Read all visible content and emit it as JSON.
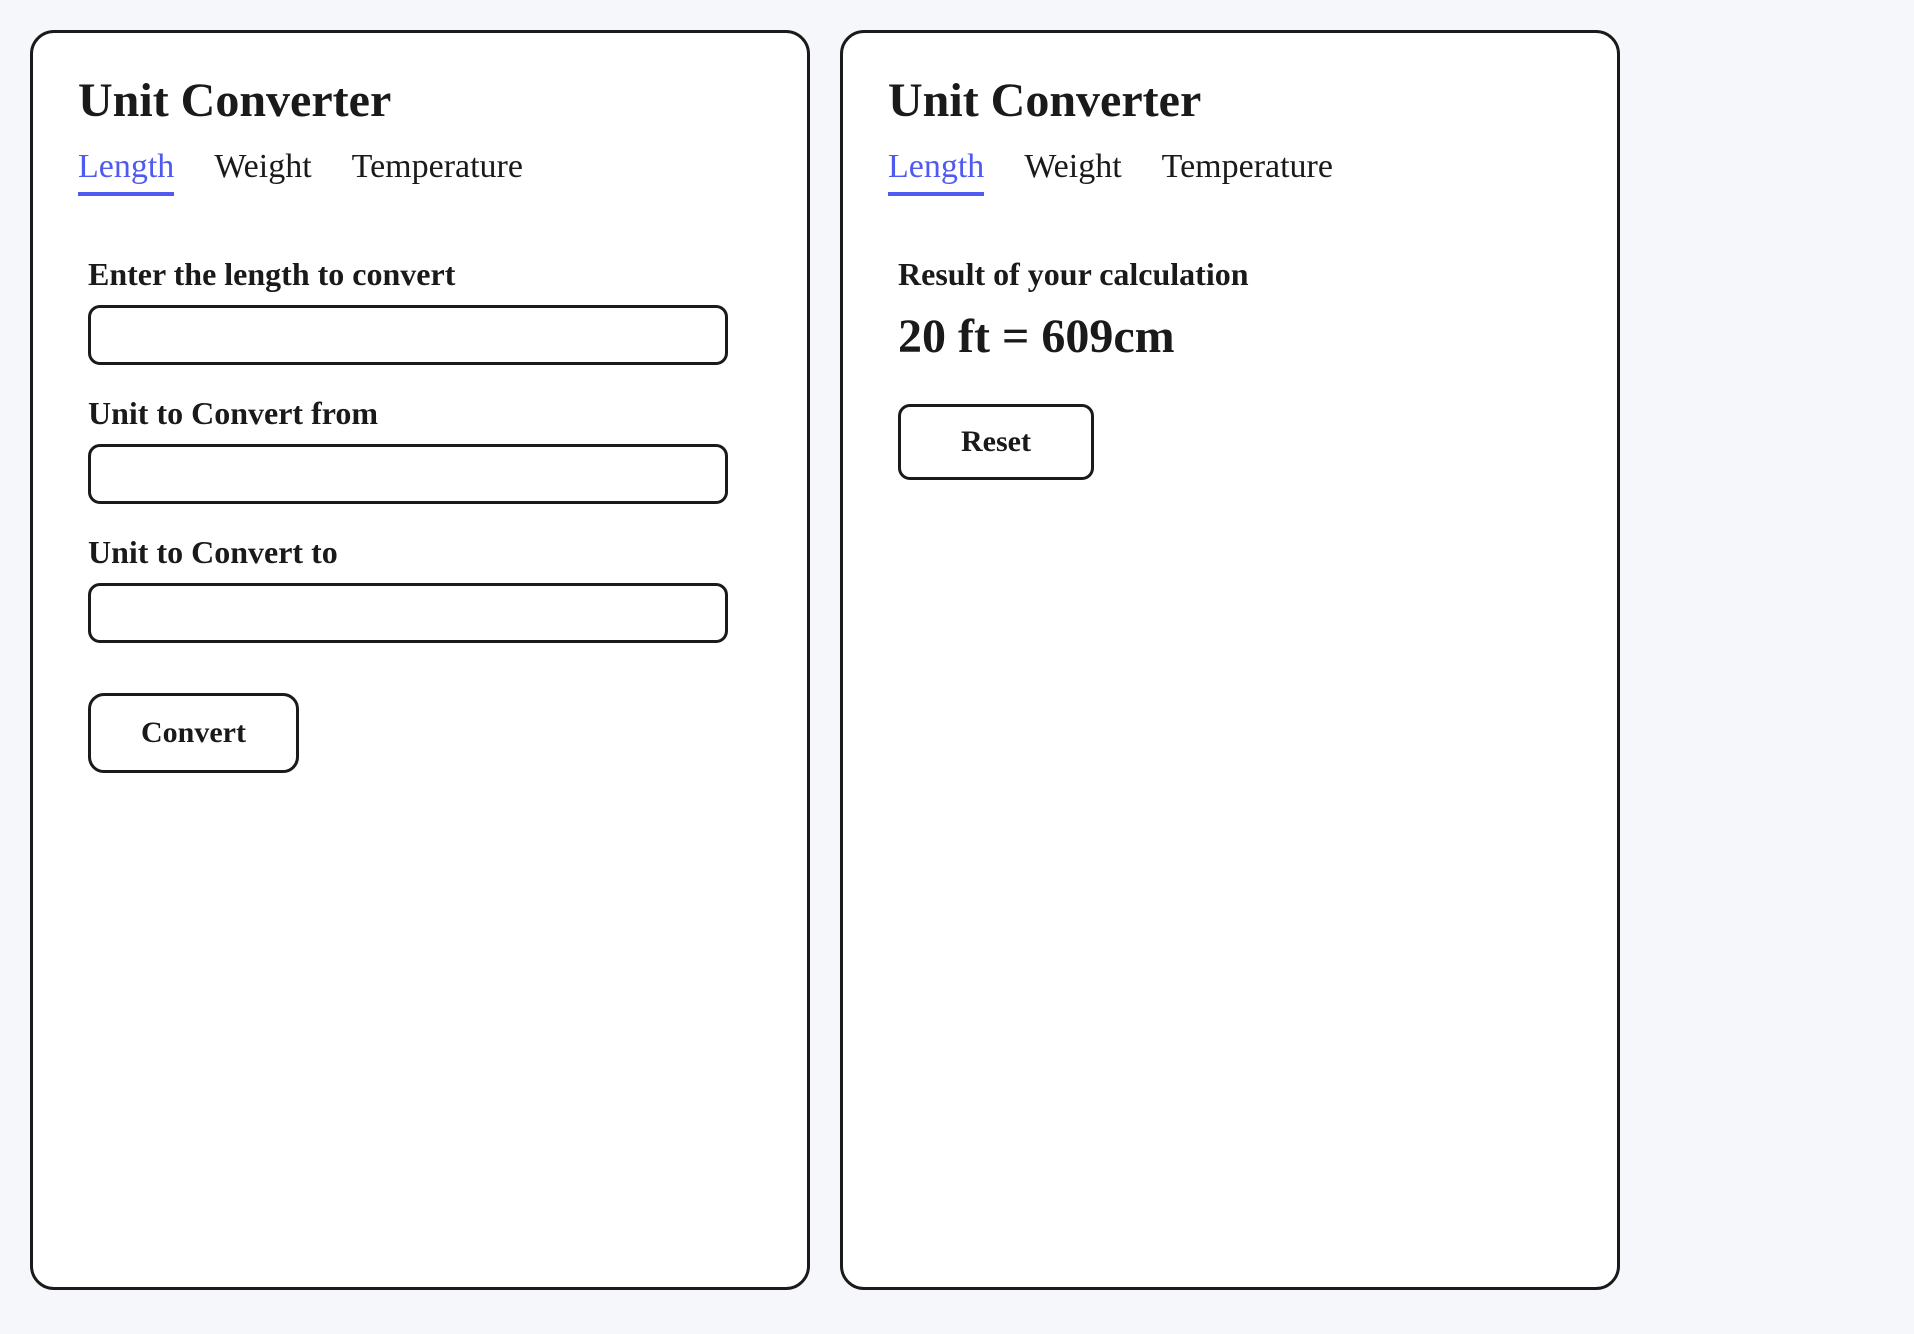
{
  "left": {
    "title": "Unit Converter",
    "tabs": {
      "length": "Length",
      "weight": "Weight",
      "temperature": "Temperature"
    },
    "form": {
      "value_label": "Enter the length to convert",
      "from_label": "Unit to Convert from",
      "to_label": "Unit to Convert to",
      "convert_button": "Convert"
    }
  },
  "right": {
    "title": "Unit Converter",
    "tabs": {
      "length": "Length",
      "weight": "Weight",
      "temperature": "Temperature"
    },
    "result": {
      "label": "Result of your calculation",
      "value": "20 ft = 609cm",
      "reset_button": "Reset"
    }
  }
}
